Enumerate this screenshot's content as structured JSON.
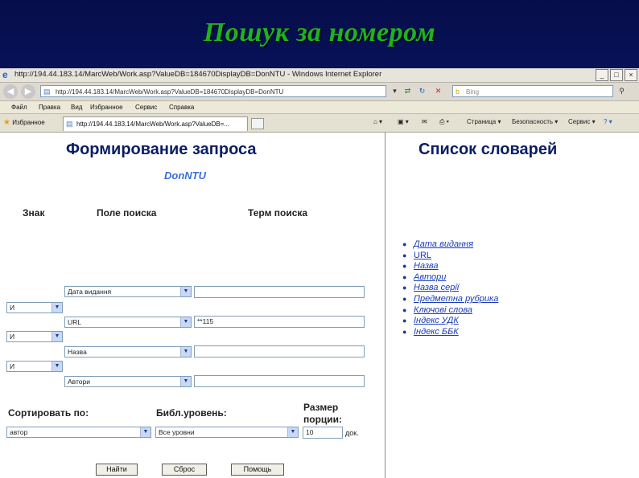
{
  "slide": {
    "title": "Пошук за номером"
  },
  "window": {
    "title": "http://194.44.183.14/MarcWeb/Work.asp?ValueDB=184670DisplayDB=DonNTU - Windows Internet Explorer",
    "controls": {
      "minimize": "_",
      "maximize": "□",
      "close": "×"
    }
  },
  "address": {
    "url": "http://194.44.183.14/MarcWeb/Work.asp?ValueDB=184670DisplayDB=DonNTU",
    "search_placeholder": "Bing"
  },
  "menu": [
    "Файл",
    "Правка",
    "Вид",
    "Избранное",
    "Сервис",
    "Справка"
  ],
  "favorites": {
    "label": "Избранное",
    "tab_title": "http://194.44.183.14/MarcWeb/Work.asp?ValueDB=...",
    "commands": {
      "page": "Страница",
      "safety": "Безопасность",
      "tools": "Сервис",
      "help": "?"
    }
  },
  "form": {
    "heading": "Формирование запроса",
    "database": "DonNTU",
    "columns": {
      "sign": "Знак",
      "field": "Поле поиска",
      "term": "Терм поиска"
    },
    "rows": [
      {
        "sign": "",
        "field": "Дата видання",
        "term": ""
      },
      {
        "sign": "И",
        "field": "URL",
        "term": "**115"
      },
      {
        "sign": "И",
        "field": "Назва",
        "term": ""
      },
      {
        "sign": "И",
        "field": "Автори",
        "term": ""
      }
    ],
    "sort_label": "Сортировать по:",
    "sort_value": "автор",
    "level_label": "Библ.уровень:",
    "level_value": "Все уровни",
    "portion_label_1": "Размер",
    "portion_label_2": "порции:",
    "portion_value": "10",
    "portion_unit": "док.",
    "buttons": {
      "find": "Найти",
      "reset": "Сброс",
      "help": "Помощь"
    }
  },
  "dictionaries": {
    "heading": "Список словарей",
    "items": [
      "Дата видання",
      "URL",
      "Назва",
      "Автори",
      "Назва серії",
      "Предметна рубрика",
      "Ключові слова",
      "Індекс УДК",
      "Індекс ББК"
    ]
  }
}
